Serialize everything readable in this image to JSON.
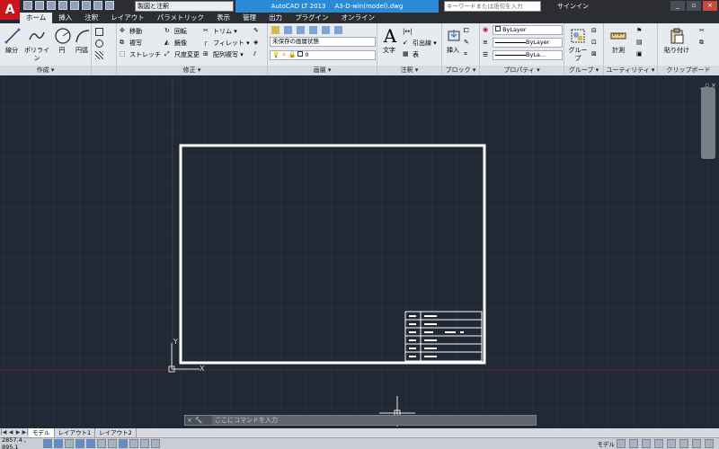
{
  "app": {
    "logo_letter": "A",
    "workspace": "製図と注釈",
    "title_app": "AutoCAD LT 2013",
    "title_file": "A3-D-win(model).dwg",
    "search_placeholder": "キーワードまたは語句を入力",
    "signin": "サインイン"
  },
  "tabs": [
    "ホーム",
    "挿入",
    "注釈",
    "レイアウト",
    "パラメトリック",
    "表示",
    "管理",
    "出力",
    "プラグイン",
    "オンライン"
  ],
  "ribbon": {
    "draw": {
      "title": "作成 ▾",
      "line": "線分",
      "polyline": "ポリライン",
      "circle": "円",
      "arc": "円弧"
    },
    "modify": {
      "title": "修正 ▾",
      "move": "移動",
      "rotate": "回転",
      "trim": "トリム ▾",
      "copy": "複写",
      "mirror": "鏡像",
      "fillet": "フィレット ▾",
      "stretch": "ストレッチ",
      "scale": "尺度変更",
      "array": "配列複写 ▾"
    },
    "layers": {
      "title": "画層 ▾",
      "state": "未保存の画層状態",
      "current": "0"
    },
    "annotation": {
      "title": "注釈 ▾",
      "text": "文字",
      "dim": "|↔|",
      "leader": "引出線 ▾",
      "table": "表"
    },
    "block": {
      "title": "ブロック ▾",
      "insert": "挿入"
    },
    "properties": {
      "title": "プロパティ ▾",
      "color": "ByLayer",
      "linetype": "ByLayer",
      "lineweight": "ByLa..."
    },
    "groups": {
      "title": "グループ ▾",
      "group": "グループ"
    },
    "utilities": {
      "title": "ユーティリティ ▾",
      "measure": "計測"
    },
    "clipboard": {
      "title": "クリップボード",
      "paste": "貼り付け"
    }
  },
  "viewport": {
    "ctrl": [
      "_",
      "▫",
      "×"
    ],
    "ucs_y": "Y",
    "ucs_x": "X"
  },
  "command": {
    "placeholder": "ここにコマンドを入力"
  },
  "layout_tabs": [
    "モデル",
    "レイアウト1",
    "レイアウト2"
  ],
  "status": {
    "coords": "2857.4 , 895.1",
    "model": "モデル"
  },
  "colors": {
    "canvas": "#222936",
    "grid": "#2c3442",
    "frame": "#ffffff",
    "accent": "#2b8ad6"
  }
}
